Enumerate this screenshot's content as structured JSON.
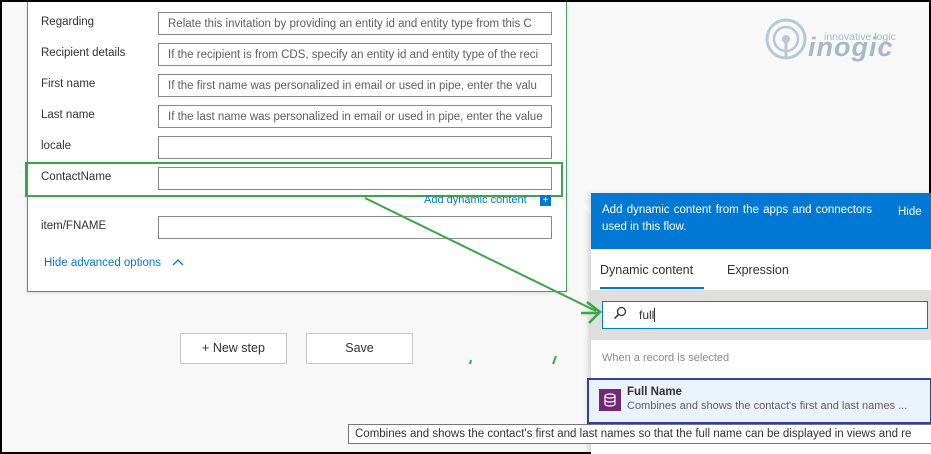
{
  "form": {
    "fields": [
      {
        "label": "Regarding",
        "value": "Relate this invitation by providing an entity id and entity type from this C"
      },
      {
        "label": "Recipient details",
        "value": "If the recipient is from CDS, specify an entity id and entity type of the reci"
      },
      {
        "label": "First name",
        "value": "If the first name was personalized in email or used in pipe, enter the valu"
      },
      {
        "label": "Last name",
        "value": "If the last name was personalized in email or used in pipe, enter the value"
      },
      {
        "label": "locale",
        "value": ""
      },
      {
        "label": "ContactName",
        "value": ""
      },
      {
        "label": "item/FNAME",
        "value": ""
      }
    ],
    "add_dynamic_label": "Add dynamic content",
    "add_dynamic_plus": "+",
    "hide_advanced_label": "Hide advanced options",
    "hide_advanced_chevron": "^"
  },
  "actions": {
    "new_step_label": "+ New step",
    "save_label": "Save"
  },
  "logo": {
    "tagline": "innovative logic",
    "wordmark": "inogic"
  },
  "dynamic_panel": {
    "header_text": "Add dynamic content from the apps and connectors used in this flow.",
    "hide_label": "Hide",
    "tabs": [
      {
        "label": "Dynamic content",
        "active": true
      },
      {
        "label": "Expression",
        "active": false
      }
    ],
    "search_value": "full",
    "section_label": "When a record is selected",
    "results": [
      {
        "title": "Full Name",
        "description": "Combines and shows the contact's first and last names ...",
        "icon": "database-icon"
      }
    ]
  },
  "tooltip": {
    "text": "Combines and shows the contact's first and last names so that the full name can be displayed in views and re"
  },
  "colors": {
    "accent": "#0078d4",
    "highlight_green": "#3aa648",
    "result_border": "#2944a8",
    "cds_icon_bg": "#742774"
  }
}
